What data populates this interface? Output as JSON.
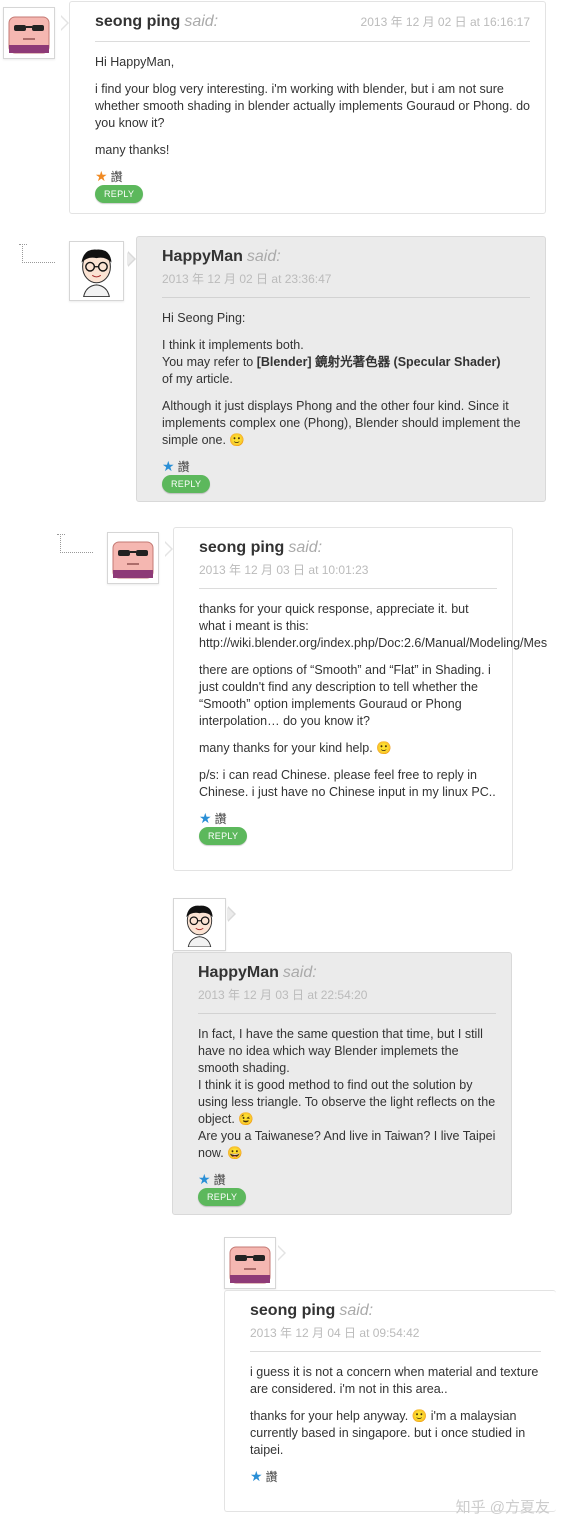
{
  "comments": [
    {
      "author": "seong ping",
      "said": "said:",
      "date": "2013 年 12 月 02 日 at 16:16:17",
      "paragraphs": [
        "Hi HappyMan,",
        "i find your blog very interesting. i'm working with blender, but i am not sure whether smooth shading in blender actually implements Gouraud or Phong. do you know it?",
        "many thanks!"
      ],
      "rate_label": "讚",
      "reply_label": "REPLY"
    },
    {
      "author": "HappyMan",
      "said": "said:",
      "date": "2013 年 12 月 02 日 at 23:36:47",
      "p1": "Hi Seong Ping:",
      "p2_line1": "I think it implements both.",
      "p2_line2_prefix": "You may refer to ",
      "p2_line2_bold": "[Blender] 鏡射光著色器 (Specular Shader)",
      "p2_line3": "of my article.",
      "p3": "Although it just displays Phong and the other four kind. Since it implements complex one (Phong), Blender should implement the simple one. 🙂",
      "rate_label": "讚",
      "reply_label": "REPLY"
    },
    {
      "author": "seong ping",
      "said": "said:",
      "date": "2013 年 12 月 03 日 at 10:01:23",
      "p1_text": "thanks for your quick response, appreciate it. but what i meant is this:",
      "p1_url": "http://wiki.blender.org/index.php/Doc:2.6/Manual/Modeling/Mes",
      "p2": "there are options of “Smooth” and “Flat” in Shading. i just couldn't find any description to tell whether the “Smooth” option implements Gouraud or Phong interpolation… do you know it?",
      "p3": "many thanks for your kind help. 🙂",
      "p4": "p/s: i can read Chinese. please feel free to reply in Chinese. i just have no Chinese input in my linux PC..",
      "rate_label": "讚",
      "reply_label": "REPLY"
    },
    {
      "author": "HappyMan",
      "said": "said:",
      "date": "2013 年 12 月 03 日 at 22:54:20",
      "p1_l1": "In fact, I have the same question that time, but I still have no idea which way Blender implemets the smooth shading.",
      "p1_l2": "I think it is good method to find out the solution by using less triangle. To observe the light reflects on the object. 😉",
      "p1_l3": "Are you a Taiwanese? And live in Taiwan? I live Taipei now. 😀",
      "rate_label": "讚",
      "reply_label": "REPLY"
    },
    {
      "author": "seong ping",
      "said": "said:",
      "date": "2013 年 12 月 04 日 at 09:54:42",
      "p1": "i guess it is not a concern when material and texture are considered. i'm not in this area..",
      "p2": "thanks for your help anyway. 🙂 i'm a malaysian currently based in singapore. but i once studied in taipei.",
      "rate_label": "讚"
    }
  ],
  "watermark": "知乎 @方夏友",
  "colors": {
    "star_orange": "#f08a24",
    "star_blue": "#2a8fd6",
    "reply_green": "#5cb85c",
    "grey_box": "#ebebeb"
  },
  "icons": {
    "seong_avatar": "bald-sunglasses-face-icon",
    "happyman_avatar": "glasses-boy-face-icon",
    "star": "star-icon"
  }
}
